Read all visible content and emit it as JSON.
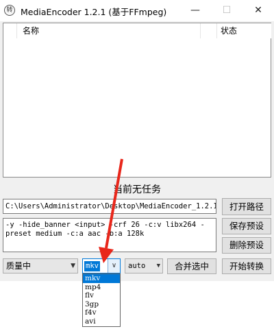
{
  "window": {
    "title": "MediaEncoder 1.2.1 (基于FFmpeg)",
    "icon_text": "转",
    "controls": {
      "minimize": "—",
      "maximize": "☐",
      "close": "✕"
    }
  },
  "task_list": {
    "columns": {
      "name": "名称",
      "status": "状态"
    }
  },
  "status_text": "当前无任务",
  "output_path": "C:\\Users\\Administrator\\Desktop\\MediaEncoder_1.2.1",
  "ffmpeg_args": "-y -hide_banner <input> -crf 26 -c:v libx264 -preset medium -c:a aac -b:a 128k",
  "buttons": {
    "open_path": "打开路径",
    "save_preset": "保存预设",
    "delete_preset": "删除预设",
    "merge_selected": "合并选中",
    "start_convert": "开始转换"
  },
  "quality_select": {
    "value": "质量中"
  },
  "format_select": {
    "value": "mkv",
    "options": [
      "mkv",
      "mp4",
      "flv",
      "3gp",
      "f4v",
      "avi"
    ],
    "highlighted": "mkv"
  },
  "auto_select": {
    "value": "auto"
  },
  "colors": {
    "accent": "#0078d7",
    "annotation_arrow": "#e8271b"
  }
}
